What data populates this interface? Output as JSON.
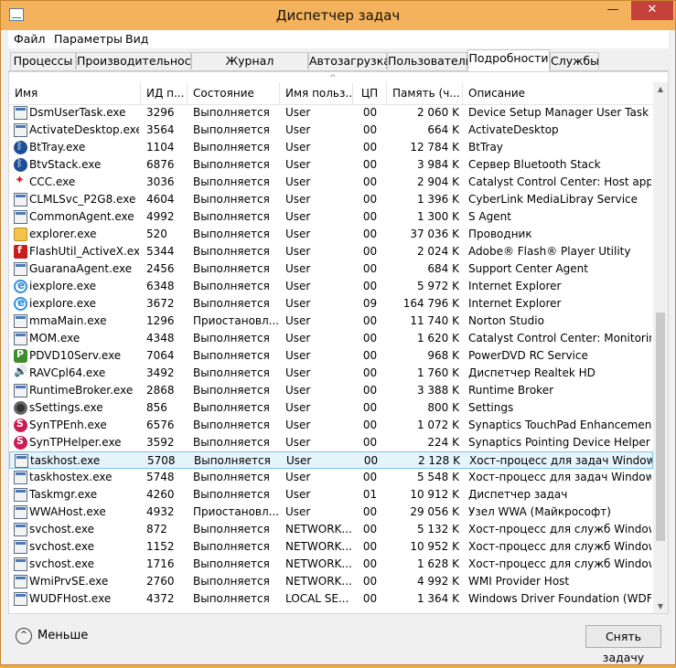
{
  "window": {
    "title": "Диспетчер задач",
    "minimize": "—",
    "maximize": "□",
    "close": "✕"
  },
  "menu": [
    "Файл",
    "Параметры",
    "Вид"
  ],
  "tabs": [
    "Процессы",
    "Производительность",
    "Журнал приложений",
    "Автозагрузка",
    "Пользователи",
    "Подробности",
    "Службы"
  ],
  "active_tab": "Подробности",
  "columns": {
    "name": "Имя",
    "pid": "ИД п...",
    "status": "Состояние",
    "user": "Имя польз...",
    "cpu": "ЦП",
    "memory": "Память (ч...",
    "description": "Описание"
  },
  "rows": [
    {
      "icon": "gen",
      "name": "DsmUserTask.exe",
      "pid": "3296",
      "status": "Выполняется",
      "user": "User",
      "cpu": "00",
      "mem": "2 060 K",
      "desc": "Device Setup Manager User Task H..."
    },
    {
      "icon": "gen",
      "name": "ActivateDesktop.exe",
      "pid": "3564",
      "status": "Выполняется",
      "user": "User",
      "cpu": "00",
      "mem": "664 K",
      "desc": "ActivateDesktop"
    },
    {
      "icon": "bt",
      "name": "BtTray.exe",
      "pid": "1104",
      "status": "Выполняется",
      "user": "User",
      "cpu": "00",
      "mem": "12 784 K",
      "desc": "BtTray"
    },
    {
      "icon": "bt",
      "name": "BtvStack.exe",
      "pid": "6876",
      "status": "Выполняется",
      "user": "User",
      "cpu": "00",
      "mem": "3 984 K",
      "desc": "Сервер Bluetooth Stack"
    },
    {
      "icon": "ccc",
      "name": "CCC.exe",
      "pid": "3036",
      "status": "Выполняется",
      "user": "User",
      "cpu": "00",
      "mem": "2 904 K",
      "desc": "Catalyst Control Center: Host appli..."
    },
    {
      "icon": "gen",
      "name": "CLMLSvc_P2G8.exe",
      "pid": "4604",
      "status": "Выполняется",
      "user": "User",
      "cpu": "00",
      "mem": "1 396 K",
      "desc": "CyberLink MediaLibray Service"
    },
    {
      "icon": "gen",
      "name": "CommonAgent.exe",
      "pid": "4992",
      "status": "Выполняется",
      "user": "User",
      "cpu": "00",
      "mem": "1 300 K",
      "desc": "S Agent"
    },
    {
      "icon": "folder",
      "name": "explorer.exe",
      "pid": "520",
      "status": "Выполняется",
      "user": "User",
      "cpu": "00",
      "mem": "37 036 K",
      "desc": "Проводник"
    },
    {
      "icon": "flash",
      "name": "FlashUtil_ActiveX.exe",
      "pid": "5344",
      "status": "Выполняется",
      "user": "User",
      "cpu": "00",
      "mem": "2 024 K",
      "desc": "Adobe® Flash® Player Utility"
    },
    {
      "icon": "gen",
      "name": "GuaranaAgent.exe",
      "pid": "2456",
      "status": "Выполняется",
      "user": "User",
      "cpu": "00",
      "mem": "684 K",
      "desc": "Support Center Agent"
    },
    {
      "icon": "ie",
      "name": "iexplore.exe",
      "pid": "6348",
      "status": "Выполняется",
      "user": "User",
      "cpu": "00",
      "mem": "5 972 K",
      "desc": "Internet Explorer"
    },
    {
      "icon": "ie",
      "name": "iexplore.exe",
      "pid": "3672",
      "status": "Выполняется",
      "user": "User",
      "cpu": "09",
      "mem": "164 796 K",
      "desc": "Internet Explorer"
    },
    {
      "icon": "gen",
      "name": "mmaMain.exe",
      "pid": "1296",
      "status": "Приостановл...",
      "user": "User",
      "cpu": "00",
      "mem": "11 740 K",
      "desc": "Norton Studio"
    },
    {
      "icon": "gen",
      "name": "MOM.exe",
      "pid": "4348",
      "status": "Выполняется",
      "user": "User",
      "cpu": "00",
      "mem": "1 620 K",
      "desc": "Catalyst Control Center: Monitorin..."
    },
    {
      "icon": "pdvd",
      "name": "PDVD10Serv.exe",
      "pid": "7064",
      "status": "Выполняется",
      "user": "User",
      "cpu": "00",
      "mem": "968 K",
      "desc": "PowerDVD RC Service"
    },
    {
      "icon": "speaker",
      "name": "RAVCpl64.exe",
      "pid": "3492",
      "status": "Выполняется",
      "user": "User",
      "cpu": "00",
      "mem": "1 760 K",
      "desc": "Диспетчер Realtek HD"
    },
    {
      "icon": "gen",
      "name": "RuntimeBroker.exe",
      "pid": "2868",
      "status": "Выполняется",
      "user": "User",
      "cpu": "00",
      "mem": "3 388 K",
      "desc": "Runtime Broker"
    },
    {
      "icon": "cam",
      "name": "sSettings.exe",
      "pid": "856",
      "status": "Выполняется",
      "user": "User",
      "cpu": "00",
      "mem": "800 K",
      "desc": "Settings"
    },
    {
      "icon": "syn",
      "name": "SynTPEnh.exe",
      "pid": "6576",
      "status": "Выполняется",
      "user": "User",
      "cpu": "00",
      "mem": "1 072 K",
      "desc": "Synaptics TouchPad Enhancements"
    },
    {
      "icon": "syn",
      "name": "SynTPHelper.exe",
      "pid": "3592",
      "status": "Выполняется",
      "user": "User",
      "cpu": "00",
      "mem": "224 K",
      "desc": "Synaptics Pointing Device Helper"
    },
    {
      "icon": "gen",
      "name": "taskhost.exe",
      "pid": "5708",
      "status": "Выполняется",
      "user": "User",
      "cpu": "00",
      "mem": "2 128 K",
      "desc": "Хост-процесс для задач Windows",
      "selected": true
    },
    {
      "icon": "gen",
      "name": "taskhostex.exe",
      "pid": "5748",
      "status": "Выполняется",
      "user": "User",
      "cpu": "00",
      "mem": "5 548 K",
      "desc": "Хост-процесс для задач Windows"
    },
    {
      "icon": "gen",
      "name": "Taskmgr.exe",
      "pid": "4260",
      "status": "Выполняется",
      "user": "User",
      "cpu": "01",
      "mem": "10 912 K",
      "desc": "Диспетчер задач"
    },
    {
      "icon": "gen",
      "name": "WWAHost.exe",
      "pid": "4932",
      "status": "Приостановл...",
      "user": "User",
      "cpu": "00",
      "mem": "29 056 K",
      "desc": "Узел WWA (Майкрософт)"
    },
    {
      "icon": "gen",
      "name": "svchost.exe",
      "pid": "872",
      "status": "Выполняется",
      "user": "NETWORK...",
      "cpu": "00",
      "mem": "5 132 K",
      "desc": "Хост-процесс для служб Windows"
    },
    {
      "icon": "gen",
      "name": "svchost.exe",
      "pid": "1152",
      "status": "Выполняется",
      "user": "NETWORK...",
      "cpu": "00",
      "mem": "10 952 K",
      "desc": "Хост-процесс для служб Windows"
    },
    {
      "icon": "gen",
      "name": "svchost.exe",
      "pid": "1716",
      "status": "Выполняется",
      "user": "NETWORK...",
      "cpu": "00",
      "mem": "1 628 K",
      "desc": "Хост-процесс для служб Windows"
    },
    {
      "icon": "gen",
      "name": "WmiPrvSE.exe",
      "pid": "2760",
      "status": "Выполняется",
      "user": "NETWORK...",
      "cpu": "00",
      "mem": "4 992 K",
      "desc": "WMI Provider Host"
    },
    {
      "icon": "gen",
      "name": "WUDFHost.exe",
      "pid": "4372",
      "status": "Выполняется",
      "user": "LOCAL SE...",
      "cpu": "00",
      "mem": "1 364 K",
      "desc": "Windows Driver Foundation (WDF) ..."
    }
  ],
  "footer": {
    "less_label": "Меньше",
    "end_task_label": "Снять задачу"
  }
}
